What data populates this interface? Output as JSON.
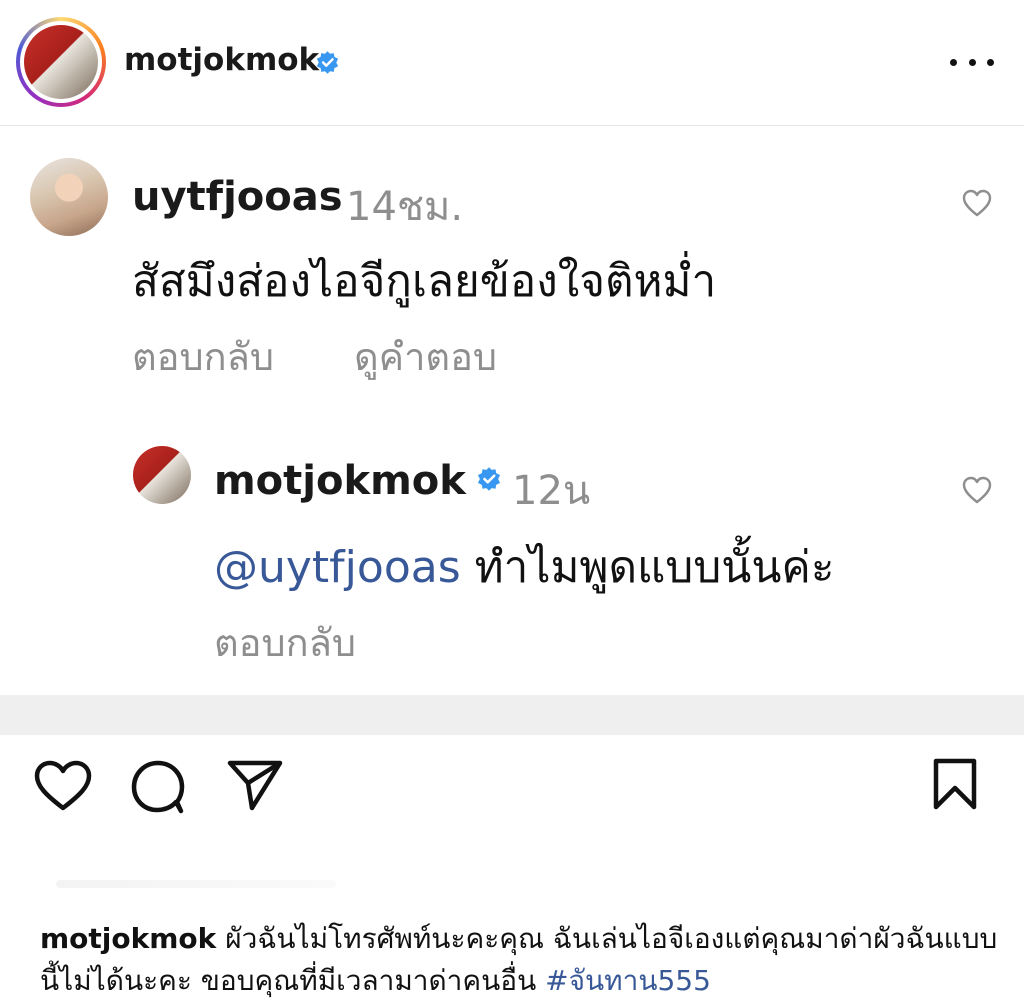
{
  "post": {
    "author": "motjokmok",
    "verified": true
  },
  "comments": [
    {
      "username": "uytfjooas",
      "time": "14ชม.",
      "text": "สัสมึงส่องไอจีกูเลยข้องใจติหม่ำ",
      "reply_label": "ตอบกลับ",
      "view_replies_label": "ดูคำตอบ"
    },
    {
      "username": "motjokmok",
      "verified": true,
      "time": "12น",
      "mention": "@uytfjooas",
      "text": " ทำไมพูดแบบนั้นค่ะ",
      "reply_label": "ตอบกลับ"
    }
  ],
  "caption": {
    "username": "motjokmok",
    "text": " ผัวฉันไม่โทรศัพท์นะคะคุณ ฉันเล่นไอจีเองแต่คุณมาด่าผัวฉันแบบนี้ไม่ได้นะคะ ขอบคุณที่มีเวลามาด่าคนอื่น ",
    "hashtag": "#จันทาน555"
  },
  "icons": {
    "more": "more-horizontal-icon",
    "like": "heart-icon",
    "comment": "comment-bubble-icon",
    "share": "paper-plane-icon",
    "save": "bookmark-icon",
    "verified": "verified-badge-icon",
    "comment_like": "heart-outline-icon"
  },
  "colors": {
    "verified_blue": "#3897f0",
    "link_blue": "#385898",
    "secondary_text": "#8e8e8e"
  }
}
